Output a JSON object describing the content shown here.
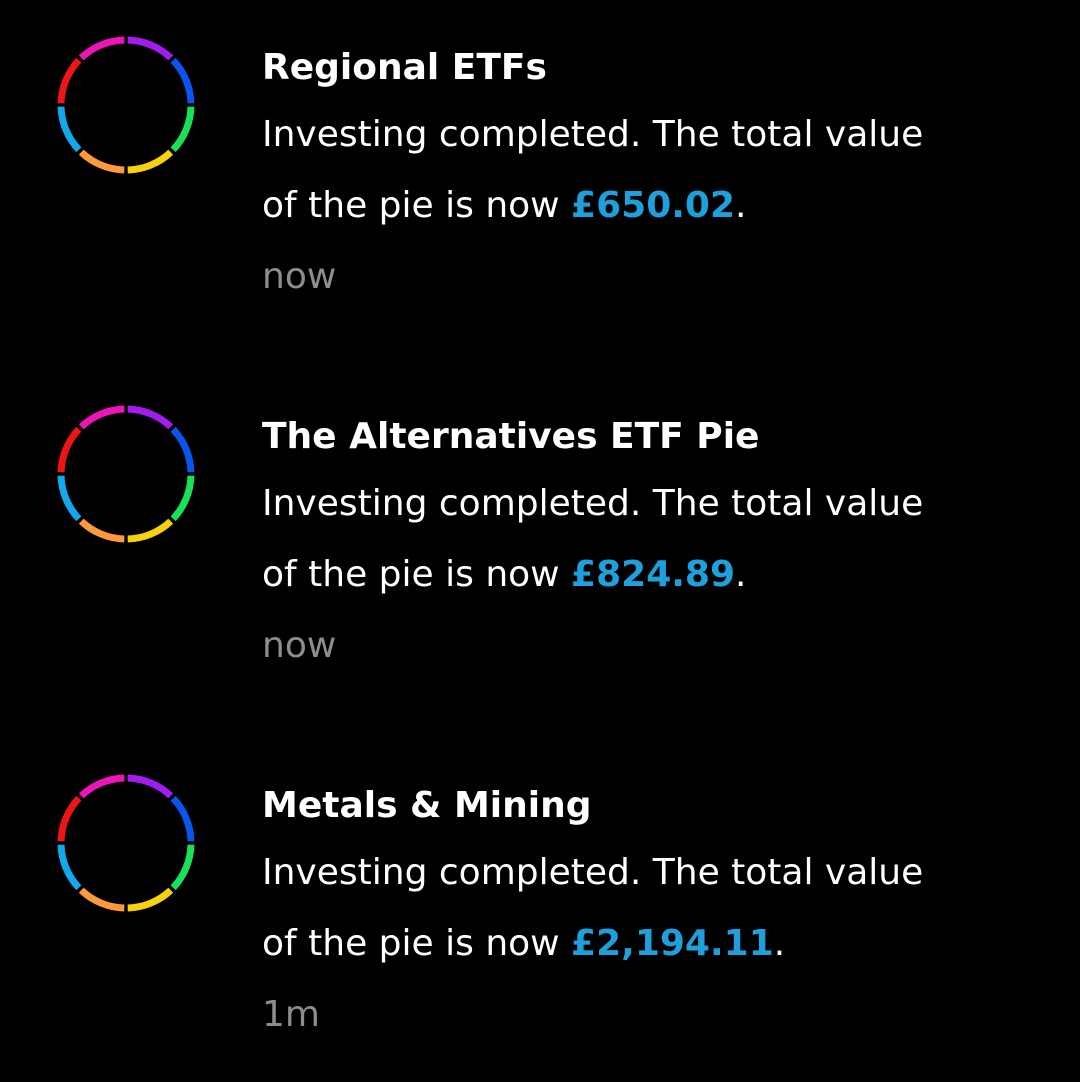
{
  "pie_icon": {
    "name": "rainbow-pie-icon",
    "segment_colors": [
      "#a21cf0",
      "#0a55f0",
      "#19e05a",
      "#f5d20a",
      "#ff9a3c",
      "#12a8ec",
      "#ee1515",
      "#ee15b8"
    ]
  },
  "colors": {
    "background": "#000000",
    "title": "#ffffff",
    "message": "#ffffff",
    "amount": "#1ea0dc",
    "timestamp": "#8d8d8d"
  },
  "notifications": [
    {
      "title": "Regional ETFs",
      "message_line1": "Investing completed. The total value",
      "message_line2_prefix": "of the pie is now ",
      "amount": "£650.02",
      "message_suffix": ".",
      "time": "now"
    },
    {
      "title": "The Alternatives ETF Pie",
      "message_line1": "Investing completed. The total value",
      "message_line2_prefix": "of the pie is now ",
      "amount": "£824.89",
      "message_suffix": ".",
      "time": "now"
    },
    {
      "title": "Metals & Mining",
      "message_line1": "Investing completed. The total value",
      "message_line2_prefix": "of the pie is now ",
      "amount": "£2,194.11",
      "message_suffix": ".",
      "time": "1m"
    }
  ]
}
